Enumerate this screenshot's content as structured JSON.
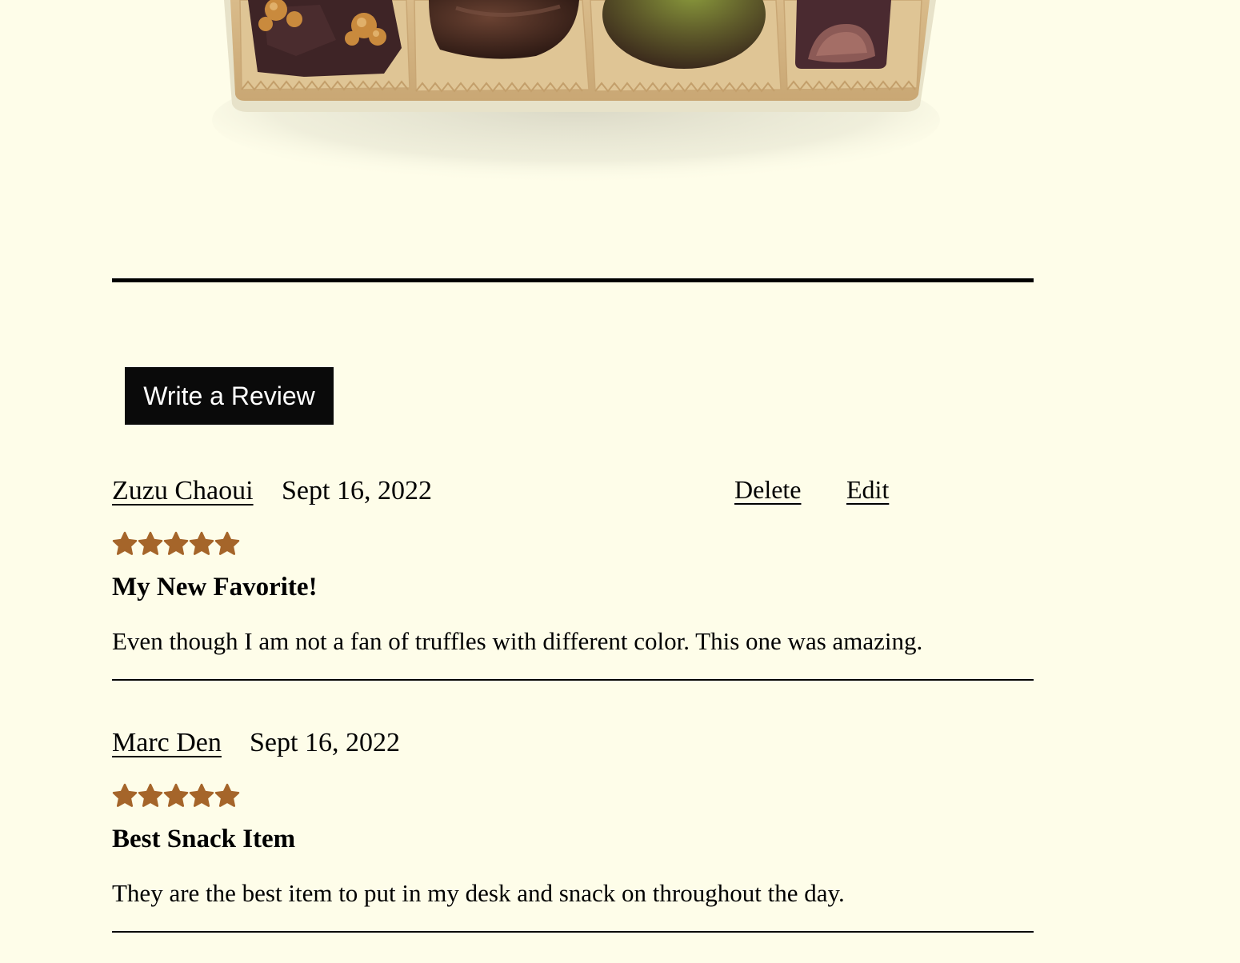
{
  "colors": {
    "background": "#fefde9",
    "star": "#a5652a",
    "button_bg": "#0a0a0a",
    "button_text": "#ffffff"
  },
  "product_image": {
    "alt": "box of assorted chocolates"
  },
  "write_review": {
    "label": "Write a Review"
  },
  "reviews": [
    {
      "name": "Zuzu Chaoui",
      "date": "Sept 16, 2022",
      "rating": 5,
      "title": "My New Favorite!",
      "body": "Even though I am not a fan of truffles with different color. This one was amazing.",
      "actions": {
        "delete": "Delete",
        "edit": "Edit"
      }
    },
    {
      "name": "Marc Den",
      "date": "Sept 16, 2022",
      "rating": 5,
      "title": "Best Snack Item",
      "body": "They are the best item to put in my desk and snack on throughout the day."
    }
  ]
}
